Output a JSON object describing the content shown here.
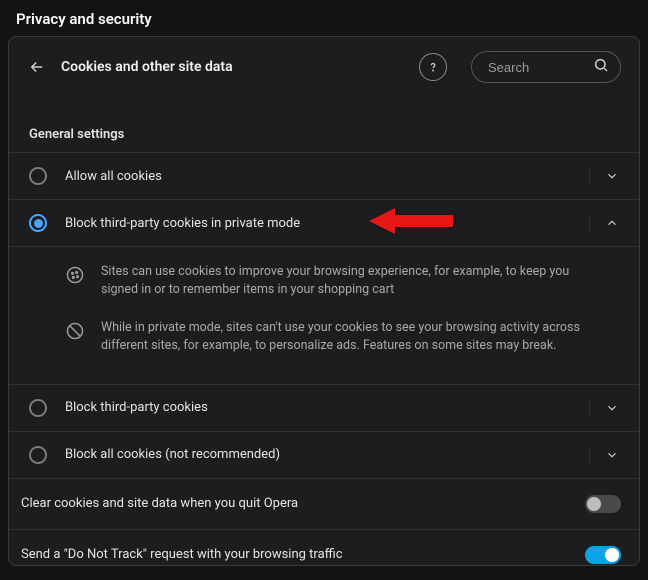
{
  "page_title": "Privacy and security",
  "header": {
    "title": "Cookies and other site data",
    "search_placeholder": "Search"
  },
  "section_heading": "General settings",
  "options": [
    {
      "label": "Allow all cookies",
      "selected": false,
      "expanded": false
    },
    {
      "label": "Block third-party cookies in private mode",
      "selected": true,
      "expanded": true
    },
    {
      "label": "Block third-party cookies",
      "selected": false,
      "expanded": false
    },
    {
      "label": "Block all cookies (not recommended)",
      "selected": false,
      "expanded": false
    }
  ],
  "details": {
    "line1": "Sites can use cookies to improve your browsing experience, for example, to keep you signed in or to remember items in your shopping cart",
    "line2": "While in private mode, sites can't use your cookies to see your browsing activity across different sites, for example, to personalize ads. Features on some sites may break."
  },
  "toggles": [
    {
      "label": "Clear cookies and site data when you quit Opera",
      "on": false
    },
    {
      "label": "Send a \"Do Not Track\" request with your browsing traffic",
      "on": true
    }
  ]
}
